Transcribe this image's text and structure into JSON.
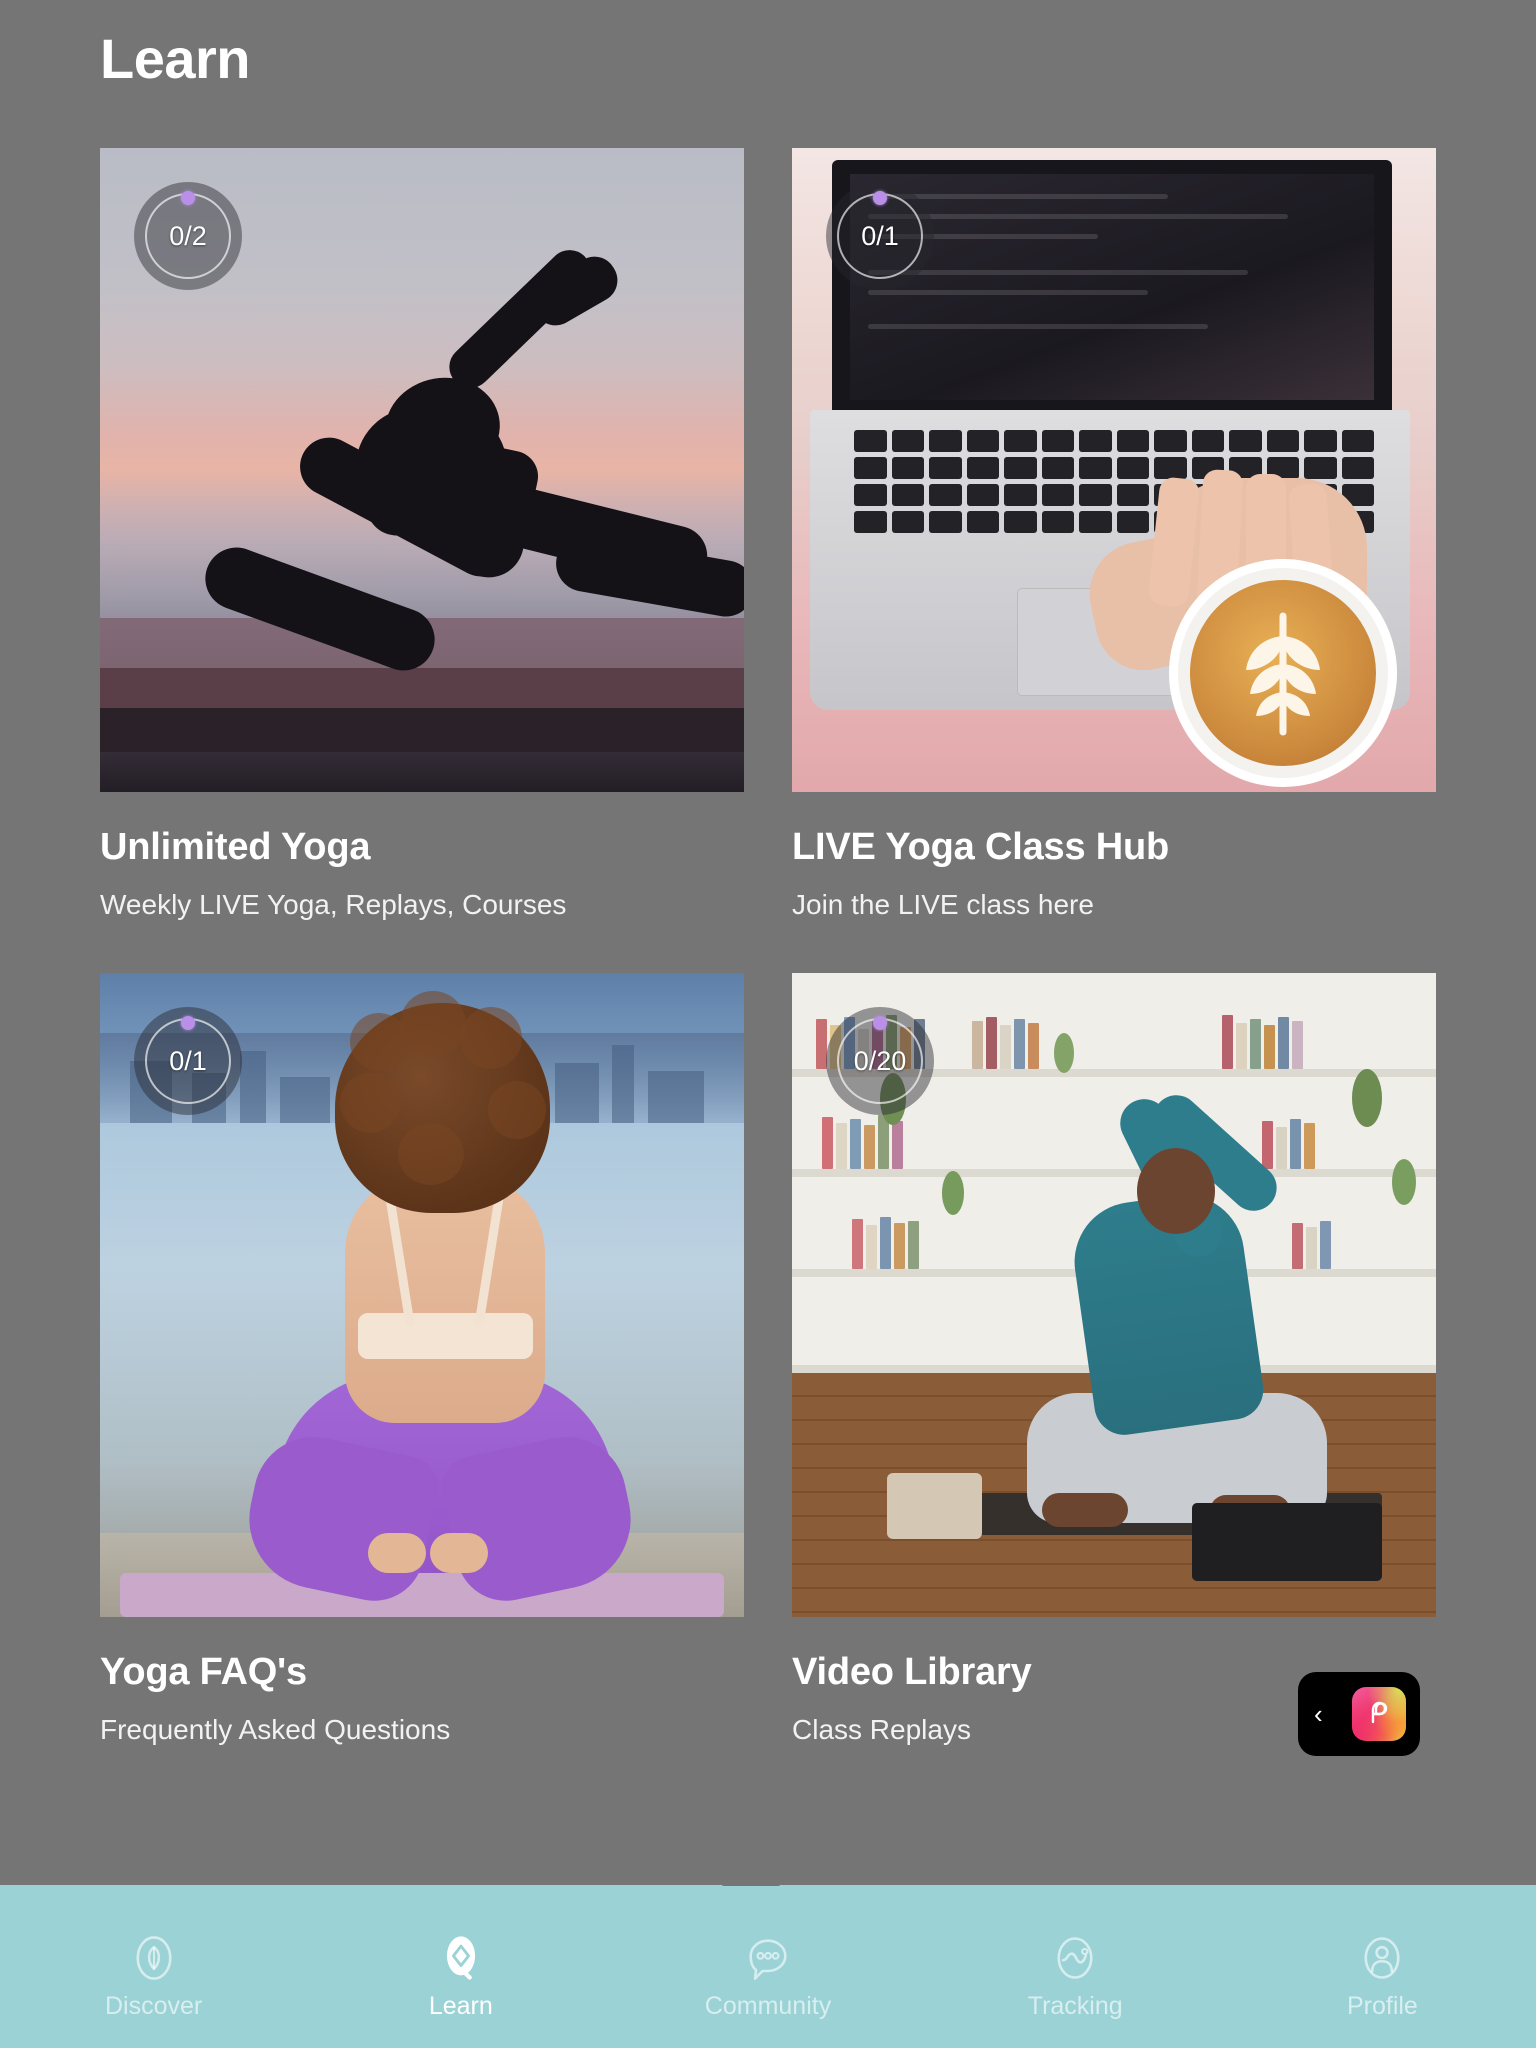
{
  "page": {
    "title": "Learn",
    "background_color": "#757575"
  },
  "cards": [
    {
      "title": "Unlimited Yoga",
      "subtitle": "Weekly LIVE Yoga, Replays,  Courses",
      "badge": "0/2",
      "image_alt": "yoga-silhouette-sunset"
    },
    {
      "title": "LIVE Yoga Class Hub",
      "subtitle": "Join the LIVE class here",
      "badge": "0/1",
      "image_alt": "laptop-and-latte"
    },
    {
      "title": "Yoga FAQ's",
      "subtitle": "Frequently Asked Questions",
      "badge": "0/1",
      "image_alt": "woman-meditating-by-lake"
    },
    {
      "title": "Video Library",
      "subtitle": "Class Replays",
      "badge": "0/20",
      "image_alt": "man-stretching-in-library"
    }
  ],
  "badge_style": {
    "dot_color": "#b98fe8",
    "ring_color": "#ffffff",
    "overlay_color": "rgba(40,40,45,0.46)"
  },
  "floating_widget": {
    "chevron": "‹",
    "logo_name": "pineapple-p-logo",
    "background_color": "#000000"
  },
  "bottom_nav": {
    "background_color": "#9ad2d6",
    "active_index": 1,
    "items": [
      {
        "label": "Discover",
        "icon": "leaf-compass-icon"
      },
      {
        "label": "Learn",
        "icon": "diamond-leaf-icon"
      },
      {
        "label": "Community",
        "icon": "chat-bubble-dots-icon"
      },
      {
        "label": "Tracking",
        "icon": "pulse-circle-icon"
      },
      {
        "label": "Profile",
        "icon": "person-icon"
      }
    ]
  }
}
